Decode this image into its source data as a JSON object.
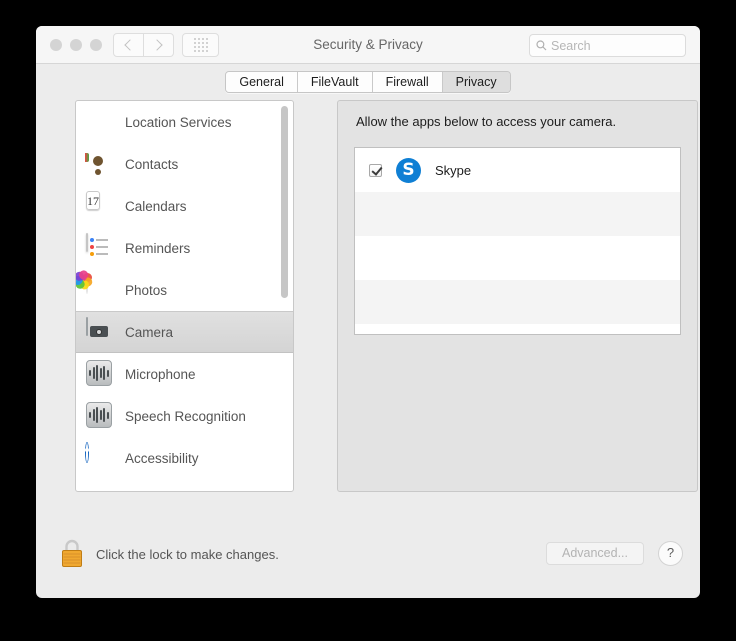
{
  "window": {
    "title": "Security & Privacy",
    "traffic_lights": [
      "close",
      "minimize",
      "zoom"
    ],
    "nav": {
      "back": "back-arrow",
      "forward": "forward-arrow",
      "grid": "show-all-grid"
    },
    "search": {
      "placeholder": "Search",
      "value": "",
      "icon": "search-icon"
    }
  },
  "tabs": [
    {
      "label": "General",
      "selected": false
    },
    {
      "label": "FileVault",
      "selected": false
    },
    {
      "label": "Firewall",
      "selected": false
    },
    {
      "label": "Privacy",
      "selected": true
    }
  ],
  "sidebar": {
    "items": [
      {
        "label": "Location Services",
        "icon": "location-services-icon",
        "selected": false
      },
      {
        "label": "Contacts",
        "icon": "contacts-icon",
        "selected": false
      },
      {
        "label": "Calendars",
        "icon": "calendars-icon",
        "selected": false,
        "day": "17"
      },
      {
        "label": "Reminders",
        "icon": "reminders-icon",
        "selected": false
      },
      {
        "label": "Photos",
        "icon": "photos-icon",
        "selected": false
      },
      {
        "label": "Camera",
        "icon": "camera-icon",
        "selected": true
      },
      {
        "label": "Microphone",
        "icon": "microphone-icon",
        "selected": false
      },
      {
        "label": "Speech Recognition",
        "icon": "speech-recognition-icon",
        "selected": false
      },
      {
        "label": "Accessibility",
        "icon": "accessibility-icon",
        "selected": false
      }
    ],
    "scrollbar": {
      "thumb_percent": 50
    }
  },
  "pane": {
    "description": "Allow the apps below to access your camera.",
    "apps": [
      {
        "name": "Skype",
        "checked": true,
        "icon": "skype-icon"
      },
      {
        "name": "",
        "checked": false,
        "icon": ""
      },
      {
        "name": "",
        "checked": false,
        "icon": ""
      },
      {
        "name": "",
        "checked": false,
        "icon": ""
      }
    ]
  },
  "footer": {
    "lock_icon": "closed-lock-icon",
    "lock_text": "Click the lock to make changes.",
    "advanced_label": "Advanced...",
    "advanced_disabled": true,
    "help_label": "?"
  },
  "colors": {
    "accent_blue": "#0f7fd4",
    "window_bg": "#ececec",
    "pane_bg": "#e3e3e3",
    "lock_gold": "#f0a830"
  }
}
